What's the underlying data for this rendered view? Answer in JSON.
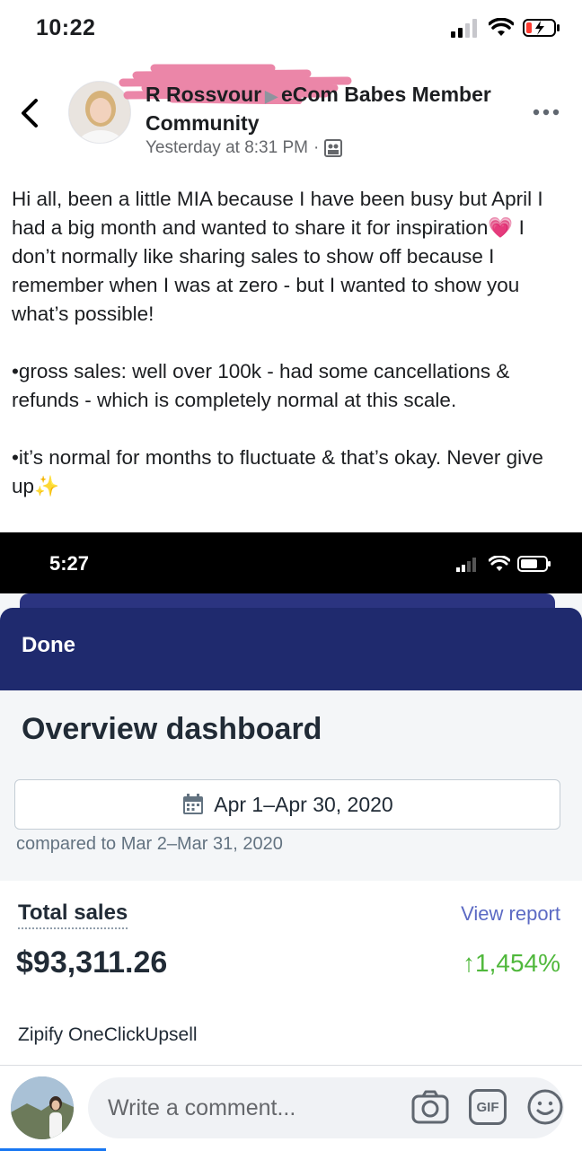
{
  "status_bar": {
    "time": "10:22"
  },
  "post": {
    "redacted_author": "R Rossvour",
    "group_name": "eCom Babes Member Community",
    "timestamp": "Yesterday at 8:31 PM",
    "audience_icon": "group-audience-icon",
    "paragraphs": [
      "Hi all, been a little MIA because I have been busy but April I had a big month and wanted to share it for inspiration💗 I don’t normally like sharing sales to show off because I remember when I was at zero - but I wanted to show you what’s possible!",
      "•gross sales: well over 100k - had some cancellations & refunds - which is completely normal at this scale.",
      "•it’s normal for months to fluctuate & that’s okay. Never give up✨"
    ]
  },
  "screenshot": {
    "status_time": "5:27",
    "done_label": "Done",
    "title": "Overview dashboard",
    "date_range": "Apr 1–Apr 30, 2020",
    "compared_to": "compared to Mar 2–Mar 31, 2020",
    "total_sales_label": "Total sales",
    "view_report_label": "View report",
    "total_sales_value": "$93,311.26",
    "change_label": "↑1,454%",
    "app_name": "Zipify OneClickUpsell"
  },
  "comment_bar": {
    "placeholder": "Write a comment...",
    "gif_label": "GIF"
  },
  "colors": {
    "redaction_pink": "#e9799f",
    "nav_blue": "#1f2a6e",
    "positive_green": "#50b83c",
    "link_purple": "#5c6ac4",
    "facebook_blue": "#1877f2"
  }
}
